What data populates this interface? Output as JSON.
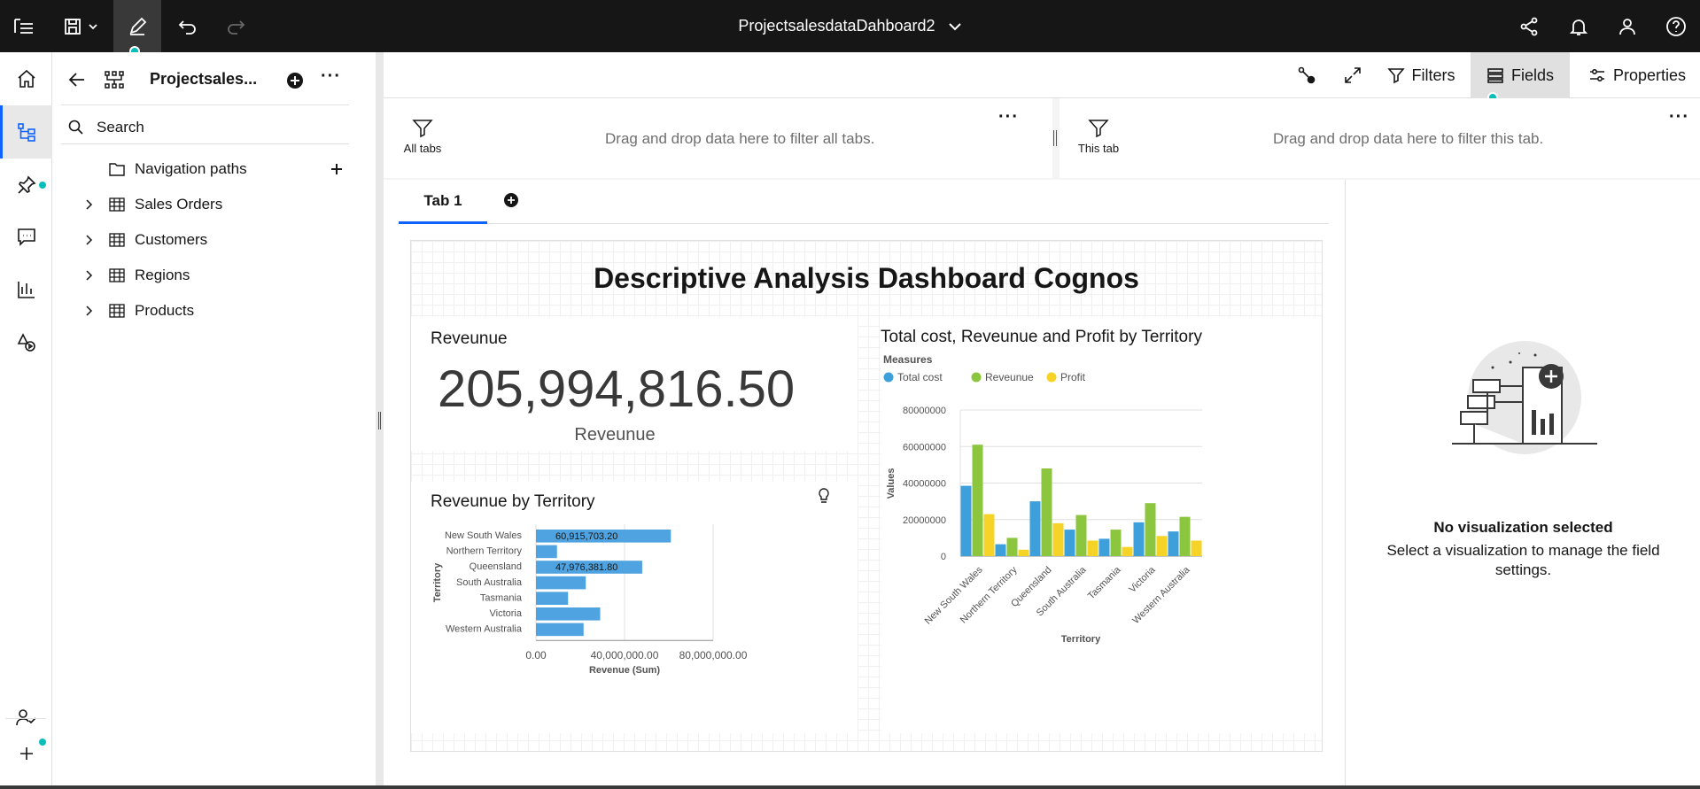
{
  "app": {
    "title": "ProjectsalesdataDahboard2"
  },
  "panel": {
    "title": "Projectsales...",
    "search_placeholder": "Search",
    "tree": [
      {
        "label": "Navigation paths",
        "icon": "folder-icon"
      },
      {
        "label": "Sales Orders",
        "icon": "table-icon"
      },
      {
        "label": "Customers",
        "icon": "table-icon"
      },
      {
        "label": "Regions",
        "icon": "table-icon"
      },
      {
        "label": "Products",
        "icon": "table-icon"
      }
    ]
  },
  "toolbar": {
    "filters_label": "Filters",
    "fields_label": "Fields",
    "properties_label": "Properties"
  },
  "filters": {
    "all_tabs_label": "All tabs",
    "all_tabs_hint": "Drag and drop data here to filter all tabs.",
    "this_tab_label": "This tab",
    "this_tab_hint": "Drag and drop data here to filter this tab."
  },
  "tabs": [
    {
      "label": "Tab 1"
    }
  ],
  "dashboard": {
    "title": "Descriptive Analysis Dashboard Cognos",
    "kpi": {
      "title": "Reveunue",
      "value": "205,994,816.50",
      "caption": "Reveunue"
    }
  },
  "properties_panel": {
    "empty_title": "No visualization selected",
    "empty_desc": "Select a visualization to manage the field settings."
  },
  "colors": {
    "bar_blue": "#4fa3e0",
    "series_blue": "#3da0db",
    "series_green": "#8cc63f",
    "series_yellow": "#f5d327",
    "accent": "#0f62fe",
    "indicator": "#08bdba"
  },
  "chart_data": [
    {
      "type": "bar",
      "orientation": "horizontal",
      "title": "Reveunue by Territory",
      "categories": [
        "New South Wales",
        "Northern Territory",
        "Queensland",
        "South Australia",
        "Tasmania",
        "Victoria",
        "Western Australia"
      ],
      "values": [
        60915703.2,
        9500000,
        47976381.8,
        22500000,
        14500000,
        29000000,
        21500000
      ],
      "data_labels": [
        "60,915,703.20",
        "",
        "47,976,381.80",
        "",
        "",
        "",
        ""
      ],
      "xlabel": "Revenue (Sum)",
      "ylabel": "Territory",
      "xlim": [
        0,
        80000000
      ],
      "xticks": [
        "0.00",
        "40,000,000.00",
        "80,000,000.00"
      ]
    },
    {
      "type": "bar",
      "title": "Total cost, Reveunue and Profit by Territory",
      "legend_title": "Measures",
      "categories": [
        "New South Wales",
        "Northern Territory",
        "Queensland",
        "South Australia",
        "Tasmania",
        "Victoria",
        "Western Australia"
      ],
      "series": [
        {
          "name": "Total cost",
          "values": [
            38500000,
            6500000,
            30000000,
            14500000,
            9500000,
            18500000,
            13500000
          ]
        },
        {
          "name": "Reveunue",
          "values": [
            61000000,
            10000000,
            48000000,
            22500000,
            14500000,
            29000000,
            21500000
          ]
        },
        {
          "name": "Profit",
          "values": [
            23000000,
            3500000,
            18000000,
            8500000,
            5000000,
            11000000,
            8500000
          ]
        }
      ],
      "xlabel": "Territory",
      "ylabel": "Values",
      "ylim": [
        0,
        80000000
      ],
      "yticks": [
        "0",
        "20000000",
        "40000000",
        "60000000",
        "80000000"
      ],
      "legend_position": "top-left"
    }
  ]
}
